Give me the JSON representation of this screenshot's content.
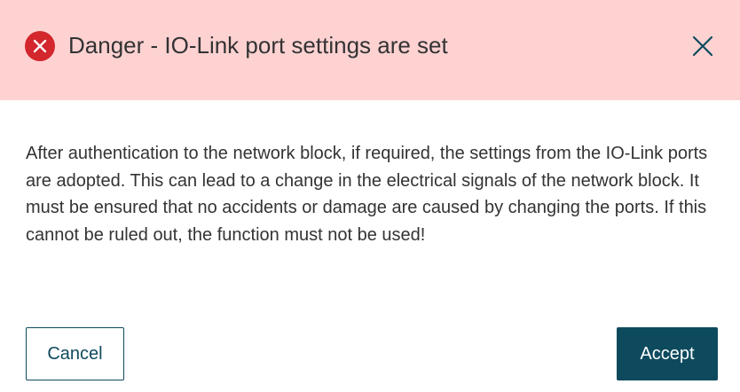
{
  "dialog": {
    "title": "Danger - IO-Link port settings are set",
    "status_icon": "error-circle-x-icon",
    "close_icon": "close-icon",
    "message": "After authentication to the network block, if required, the settings from the IO-Link ports are adopted. This can lead to a change in the electrical signals of the network block. It must be ensured that no accidents or damage are caused by changing the ports. If this cannot be ruled out, the function must not be used!",
    "cancel_label": "Cancel",
    "accept_label": "Accept"
  },
  "colors": {
    "header_background": "#ffd2d2",
    "danger_red": "#d3262d",
    "primary": "#0e4a5e",
    "text": "#333333"
  }
}
